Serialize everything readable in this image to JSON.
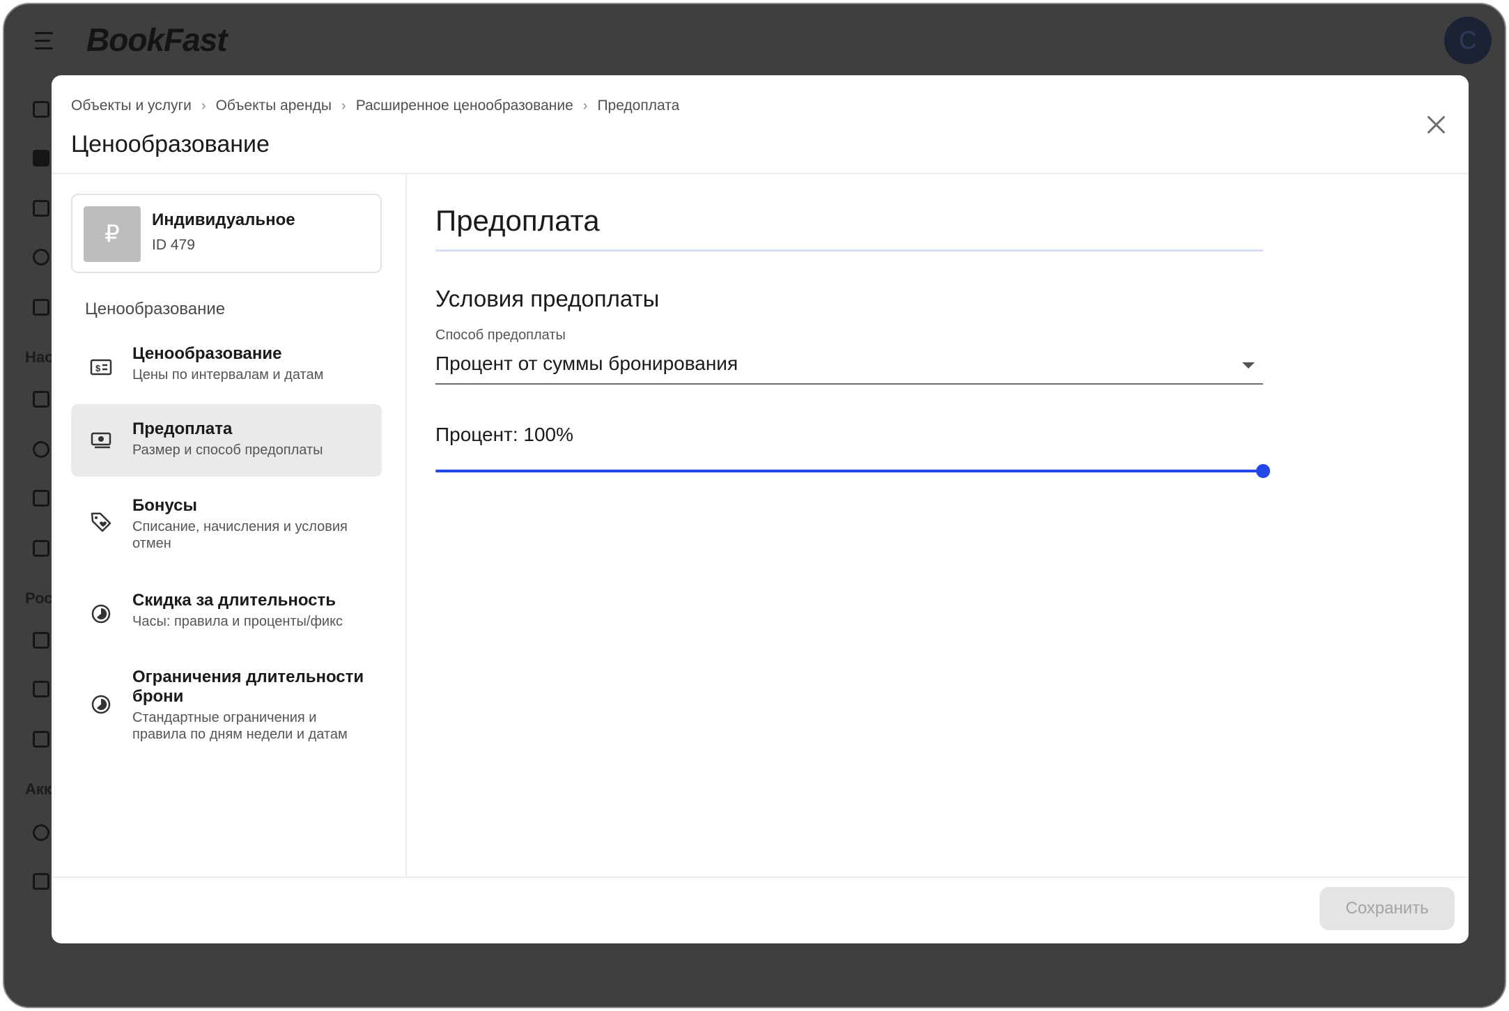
{
  "app": {
    "logo": "BookFast",
    "avatar_initial": "C"
  },
  "background_sidebar": {
    "labels": [
      "Нас",
      "Рос",
      "Акк"
    ]
  },
  "modal": {
    "breadcrumb": [
      "Объекты и услуги",
      "Объекты аренды",
      "Расширенное ценообразование",
      "Предоплата"
    ],
    "title": "Ценообразование",
    "close_icon": "close-icon"
  },
  "object_card": {
    "thumb_symbol": "₽",
    "name": "Индивидуальное",
    "id_label": "ID 479"
  },
  "left_nav": {
    "section_label": "Ценообразование",
    "items": [
      {
        "title": "Ценообразование",
        "subtitle": "Цены по интервалам и датам",
        "icon": "price-tag-money-icon",
        "active": false
      },
      {
        "title": "Предоплата",
        "subtitle": "Размер и способ предоплаты",
        "icon": "banknote-icon",
        "active": true
      },
      {
        "title": "Бонусы",
        "subtitle": "Списание, начисления и условия отмен",
        "icon": "tag-heart-icon",
        "active": false
      },
      {
        "title": "Скидка за длительность",
        "subtitle": "Часы: правила и проценты/фикс",
        "icon": "clock-icon",
        "active": false
      },
      {
        "title": "Ограничения длительности брони",
        "subtitle": "Стандартные ограничения и правила по дням недели и датам",
        "icon": "clock-icon",
        "active": false
      }
    ]
  },
  "content": {
    "title": "Предоплата",
    "conditions_title": "Условия предоплаты",
    "method_label": "Способ предоплаты",
    "method_value": "Процент от суммы бронирования",
    "percent_label": "Процент: 100%",
    "percent_value": 100
  },
  "footer": {
    "save_label": "Сохранить"
  },
  "colors": {
    "accent": "#2347e8",
    "overlay": "#3f3f3f",
    "active_item": "#eaeaea"
  }
}
